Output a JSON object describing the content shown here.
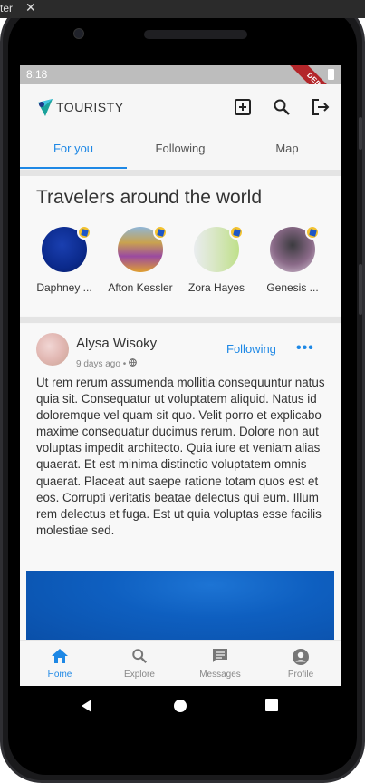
{
  "desktop": {
    "left_text": "ter",
    "close_glyph": "✕"
  },
  "status_bar": {
    "time": "8:18",
    "debug_label": "DEBUG"
  },
  "app_bar": {
    "logo_text": "TOURISTY",
    "actions": [
      {
        "name": "add-post-icon",
        "icon": "add-box"
      },
      {
        "name": "search-icon",
        "icon": "search"
      },
      {
        "name": "logout-icon",
        "icon": "logout"
      }
    ]
  },
  "tabs": [
    {
      "label": "For you",
      "active": true
    },
    {
      "label": "Following",
      "active": false
    },
    {
      "label": "Map",
      "active": false
    }
  ],
  "travelers": {
    "title": "Travelers around the world",
    "items": [
      {
        "name": "Daphney ...",
        "avatar_color": "#0a2a8a"
      },
      {
        "name": "Afton Kessler",
        "avatar_color": "#d48a2c"
      },
      {
        "name": "Zora Hayes",
        "avatar_color": "#c8e0a0"
      },
      {
        "name": "Genesis ...",
        "avatar_color": "#8a6a88"
      }
    ]
  },
  "post": {
    "author": "Alysa Wisoky",
    "time_ago": "9 days ago •",
    "visibility_icon": "globe-icon",
    "follow_label": "Following",
    "more_label": "•••",
    "body": "Ut rem rerum assumenda mollitia consequuntur natus quia sit. Consequatur ut voluptatem aliquid. Natus id doloremque vel quam sit quo. Velit porro et explicabo maxime consequatur ducimus rerum. Dolore non aut voluptas impedit architecto. Quia iure et veniam alias quaerat. Et est minima distinctio voluptatem omnis quaerat. Placeat aut saepe ratione totam quos est et eos. Corrupti veritatis beatae delectus qui eum. Illum rem delectus et fuga. Est ut quia voluptas esse facilis molestiae sed."
  },
  "bottom_nav": [
    {
      "label": "Home",
      "icon": "home-icon",
      "active": true
    },
    {
      "label": "Explore",
      "icon": "search-icon",
      "active": false
    },
    {
      "label": "Messages",
      "icon": "message-icon",
      "active": false
    },
    {
      "label": "Profile",
      "icon": "profile-icon",
      "active": false
    }
  ],
  "colors": {
    "accent": "#1e88e5",
    "debug_banner": "#b3262a"
  }
}
